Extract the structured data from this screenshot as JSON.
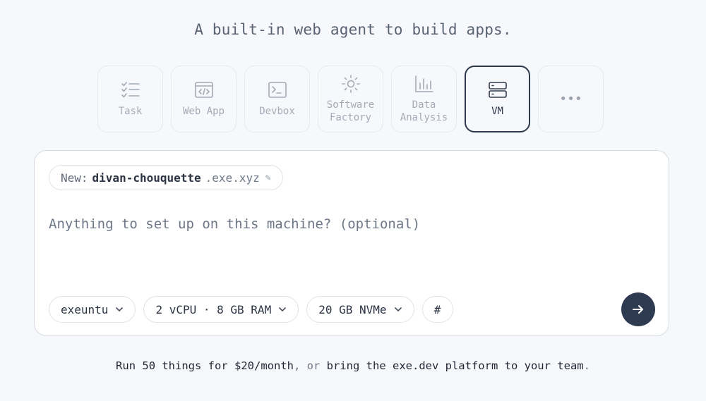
{
  "headline": "A built-in web agent to build apps.",
  "tiles": [
    {
      "label": "Task",
      "icon": "checklist-icon"
    },
    {
      "label": "Web App",
      "icon": "browser-code-icon"
    },
    {
      "label": "Devbox",
      "icon": "terminal-icon"
    },
    {
      "label": "Software\nFactory",
      "icon": "sun-gear-icon"
    },
    {
      "label": "Data\nAnalysis",
      "icon": "bar-chart-icon"
    },
    {
      "label": "VM",
      "icon": "server-stack-icon",
      "selected": true
    },
    {
      "label": "•••",
      "icon": "more-icon"
    }
  ],
  "machine": {
    "prefix": "New:",
    "name": "divan-chouquette",
    "suffix": ".exe.xyz",
    "edit_icon": "✎"
  },
  "prompt": {
    "placeholder": "Anything to set up on this machine? (optional)",
    "value": ""
  },
  "options": {
    "image": "exeuntu",
    "size": "2 vCPU · 8 GB RAM",
    "disk": "20 GB NVMe",
    "tag": "#"
  },
  "footer": {
    "part1": "Run 50 things for $20/month",
    "separator": ", or ",
    "part2": "bring the exe.dev platform to your team",
    "end": "."
  },
  "colors": {
    "accent": "#2e3a4f",
    "background": "#f7f8fb",
    "tile_text": "#a4abb7"
  }
}
